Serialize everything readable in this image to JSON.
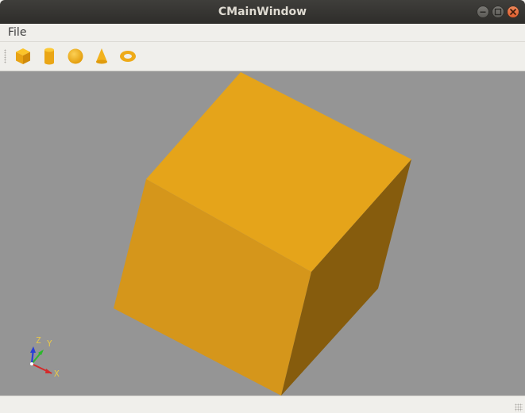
{
  "window": {
    "title": "CMainWindow",
    "buttons": [
      "minimize-icon",
      "maximize-icon",
      "close-icon"
    ]
  },
  "menubar": {
    "items": [
      {
        "label": "File"
      }
    ]
  },
  "toolbar": {
    "tools": [
      {
        "icon": "box-icon",
        "shape": "box"
      },
      {
        "icon": "cylinder-icon",
        "shape": "cylinder"
      },
      {
        "icon": "sphere-icon",
        "shape": "sphere"
      },
      {
        "icon": "cone-icon",
        "shape": "cone"
      },
      {
        "icon": "torus-icon",
        "shape": "torus"
      }
    ]
  },
  "viewport": {
    "background": "#959595",
    "object": "box",
    "object_colors": {
      "top": "#e5a41a",
      "left": "#d5961b",
      "right": "#865c0d"
    }
  },
  "axes_indicator": {
    "x_label": "X",
    "y_label": "Y",
    "z_label": "Z",
    "x_color": "#d42b2b",
    "y_color": "#2cb82c",
    "z_color": "#2a3fd6",
    "label_color": "#e8c84a"
  },
  "statusbar": {
    "text": ""
  }
}
